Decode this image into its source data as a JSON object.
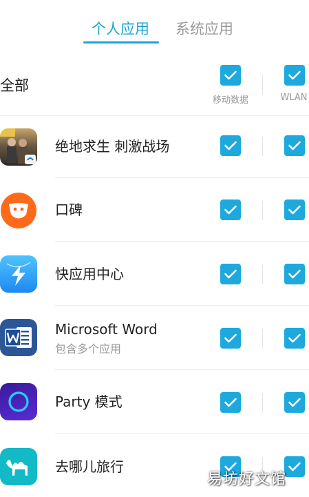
{
  "tabs": {
    "personal": "个人应用",
    "system": "系统应用"
  },
  "header": {
    "all_label": "全部",
    "mobile_data_label": "移动数据",
    "wlan_label": "WLAN",
    "mobile_data_checked": true,
    "wlan_checked": true
  },
  "apps": [
    {
      "name": "绝地求生 刺激战场",
      "subtitle": "",
      "icon": "pubg-game-icon",
      "mobile_data": true,
      "wlan": true
    },
    {
      "name": "口碑",
      "subtitle": "",
      "icon": "koubei-smile-icon",
      "mobile_data": true,
      "wlan": true
    },
    {
      "name": "快应用中心",
      "subtitle": "",
      "icon": "quick-app-lightning-icon",
      "mobile_data": true,
      "wlan": true
    },
    {
      "name": "Microsoft Word",
      "subtitle": "包含多个应用",
      "icon": "word-icon",
      "mobile_data": true,
      "wlan": true
    },
    {
      "name": "Party 模式",
      "subtitle": "",
      "icon": "party-ring-icon",
      "mobile_data": true,
      "wlan": true
    },
    {
      "name": "去哪儿旅行",
      "subtitle": "",
      "icon": "qunar-camel-icon",
      "mobile_data": true,
      "wlan": true
    }
  ],
  "colors": {
    "accent": "#1aa3d6",
    "checkbox": "#1ea9de",
    "inactive_text": "#999999"
  },
  "watermark": "易坊好文馆"
}
